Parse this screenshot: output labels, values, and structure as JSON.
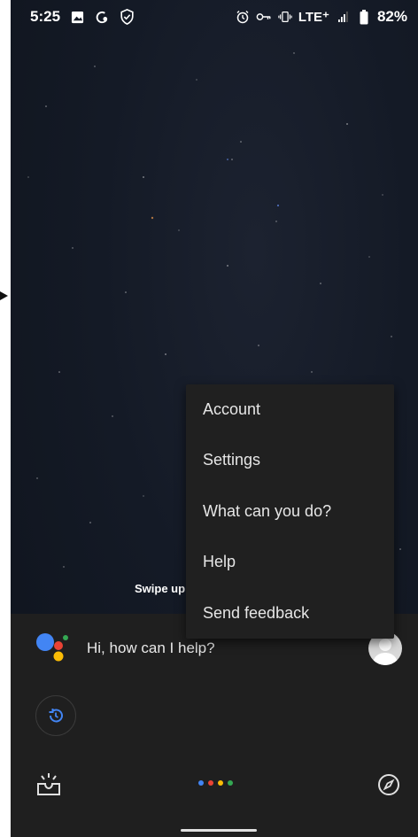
{
  "status_bar": {
    "time": "5:25",
    "network": "LTE⁺",
    "battery": "82%",
    "icons_left": [
      "image-icon",
      "assistant-icon",
      "shield-icon"
    ],
    "icons_right": [
      "alarm-icon",
      "vpn-key-icon",
      "vibrate-icon",
      "signal-icon",
      "battery-icon"
    ]
  },
  "wallpaper": {
    "swipe_hint": "Swipe up"
  },
  "assistant": {
    "greeting": "Hi, how can I help?",
    "colors": {
      "blue": "#4285F4",
      "red": "#EA4335",
      "yellow": "#FBBC05",
      "green": "#34A853"
    }
  },
  "overflow_menu": {
    "items": [
      {
        "label": "Account"
      },
      {
        "label": "Settings"
      },
      {
        "label": "What can you do?"
      },
      {
        "label": "Help"
      },
      {
        "label": "Send feedback"
      }
    ]
  },
  "bottom_bar": {
    "left_icon": "snapshot-icon",
    "right_icon": "explore-compass-icon"
  }
}
